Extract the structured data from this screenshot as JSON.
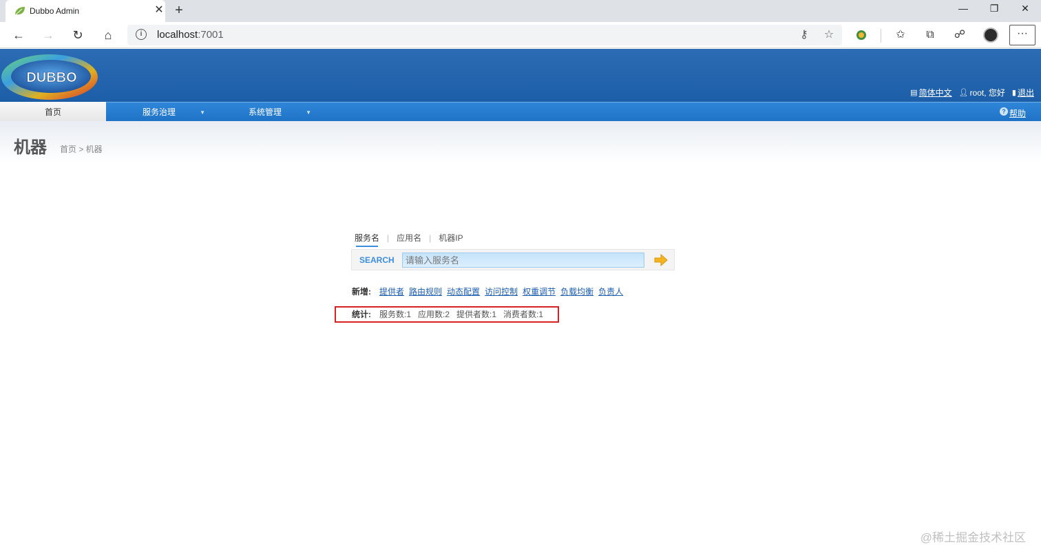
{
  "browser": {
    "tab_title": "Dubbo Admin",
    "tab_close": "✕",
    "new_tab": "+",
    "url_host": "localhost",
    "url_port": ":7001",
    "more": "···"
  },
  "header": {
    "logo_text": "DUBBO",
    "language_link": "简体中文",
    "user_greeting": "root, 您好",
    "logout_link": "退出"
  },
  "nav": {
    "items": [
      {
        "label": "首页"
      },
      {
        "label": "服务治理"
      },
      {
        "label": "系统管理"
      }
    ],
    "help_link": "帮助"
  },
  "page": {
    "title": "机器",
    "breadcrumb": "首页 > 机器"
  },
  "search": {
    "tabs": [
      "服务名",
      "应用名",
      "机器IP"
    ],
    "label": "SEARCH",
    "placeholder": "请输入服务名"
  },
  "add": {
    "label": "新增:",
    "links": [
      "提供者",
      "路由规则",
      "动态配置",
      "访问控制",
      "权重调节",
      "负载均衡",
      "负责人"
    ]
  },
  "stats": {
    "label": "统计:",
    "items": [
      "服务数:1",
      "应用数:2",
      "提供者数:1",
      "消费者数:1"
    ]
  },
  "watermark": "@稀土掘金技术社区",
  "colors": {
    "header_blue": "#1d5ea8",
    "nav_blue": "#1f73c6",
    "link_blue": "#1a5cb0",
    "highlight_red": "#d42020"
  }
}
